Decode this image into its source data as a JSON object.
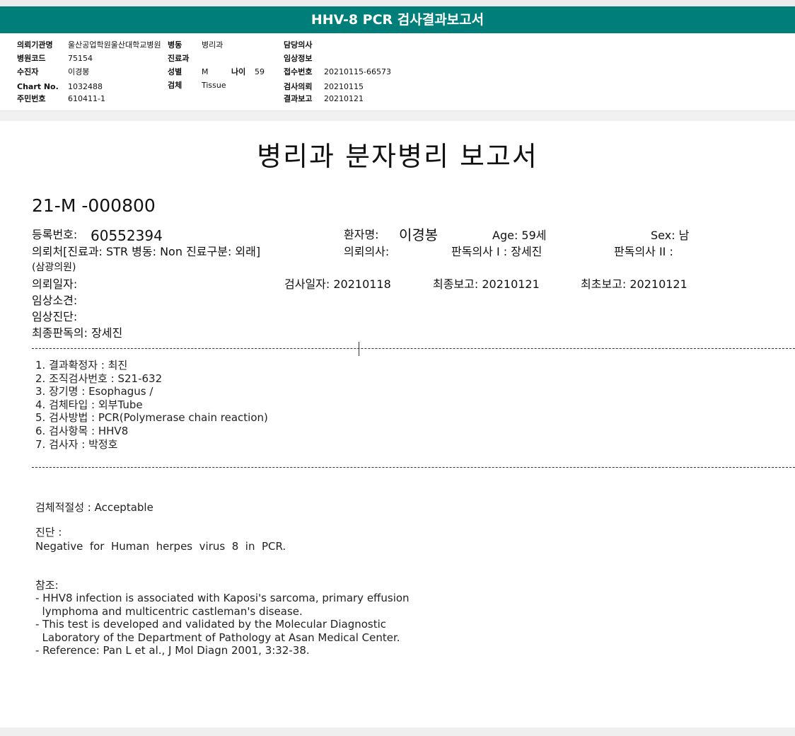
{
  "banner": {
    "title": "HHV-8 PCR 검사결과보고서"
  },
  "header": {
    "col1": [
      {
        "label": "의뢰기관명",
        "value": "울산공업학원울산대학교병원"
      },
      {
        "label": "병원코드",
        "value": "75154"
      },
      {
        "label": "수진자",
        "value": "이경봉"
      },
      {
        "label": "Chart No.",
        "value": "1032488"
      },
      {
        "label": "주민번호",
        "value": "610411-1"
      }
    ],
    "col2": [
      {
        "label": "병동",
        "value": "병리과"
      },
      {
        "label": "진료과",
        "value": ""
      },
      {
        "label": "성별",
        "value": "M"
      },
      {
        "label": "검체",
        "value": "Tissue"
      }
    ],
    "age": {
      "label": "나이",
      "value": "59"
    },
    "col3": [
      {
        "label": "담당의사",
        "value": ""
      },
      {
        "label": "임상정보",
        "value": ""
      },
      {
        "label": "접수번호",
        "value": "20210115-66573"
      },
      {
        "label": "검사의뢰",
        "value": "20210115"
      },
      {
        "label": "결과보고",
        "value": "20210121"
      }
    ]
  },
  "report": {
    "title": "병리과 분자병리 보고서",
    "code": "21-M -000800",
    "reg_label": "등록번호:",
    "reg_value": "60552394",
    "patient_label": "환자명:",
    "patient_value": "이경봉",
    "age_text": "Age:  59세",
    "sex_text": "Sex:  남",
    "referrer": "의뢰처[진료과: STR 병동: Non 진료구분: 외래]",
    "referrer2": "(삼광의원)",
    "ref_doctor": "의뢰의사:",
    "reader1": "판독의사 I : 장세진",
    "reader2": "판독의사 II :",
    "req_date": "의뢰일자:",
    "test_date": "검사일자: 20210118",
    "final_report": "최종보고: 20210121",
    "first_report": "최초보고: 20210121",
    "clinical_finding": "임상소견:",
    "clinical_dx": "임상진단:",
    "final_reader": "최종판독의: 장세진"
  },
  "items": [
    "1. 결과확정자 :  최진",
    "2. 조직검사번호 : S21-632",
    "3. 장기명 : Esophagus /",
    "4. 검체타입 : 외부Tube",
    "5. 검사방법 : PCR(Polymerase chain reaction)",
    "6. 검사항목 : HHV8",
    "7. 검사자 : 박정호"
  ],
  "adequacy": "검체적절성 : Acceptable",
  "diagnosis_label": "진단 :",
  "diagnosis": "Negative  for  Human  herpes  virus  8  in  PCR.",
  "reference_label": "참조:",
  "references": [
    "- HHV8 infection is associated with Kaposi's sarcoma, primary effusion",
    "  lymphoma and multicentric castleman's disease.",
    "- This test is developed and validated by the Molecular Diagnostic",
    "  Laboratory of the Department of Pathology at Asan Medical Center.",
    "- Reference: Pan L et al., J Mol Diagn 2001, 3:32-38."
  ]
}
